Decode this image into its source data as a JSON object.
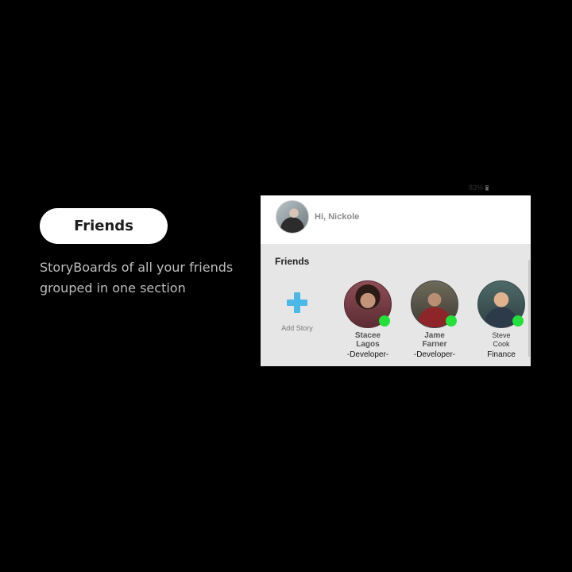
{
  "intro": {
    "title": "Friends",
    "caption": "StoryBoards of all your friends grouped in one section"
  },
  "status_bar": {
    "battery": "83%"
  },
  "header": {
    "greeting": "Hi, Nickole"
  },
  "friends_section": {
    "title": "Friends",
    "add_story_label": "Add Story",
    "friends": [
      {
        "name_line1": "Stacee",
        "name_line2": "Lagos",
        "role": "-Developer-",
        "online": true
      },
      {
        "name_line1": "Jame",
        "name_line2": "Farner",
        "role": "-Developer-",
        "online": true
      },
      {
        "name_line1": "Steve",
        "name_line2": "Cook",
        "role": "Finance",
        "online": true
      }
    ]
  },
  "colors": {
    "online": "#22e13a",
    "accent": "#4cb8e8"
  }
}
